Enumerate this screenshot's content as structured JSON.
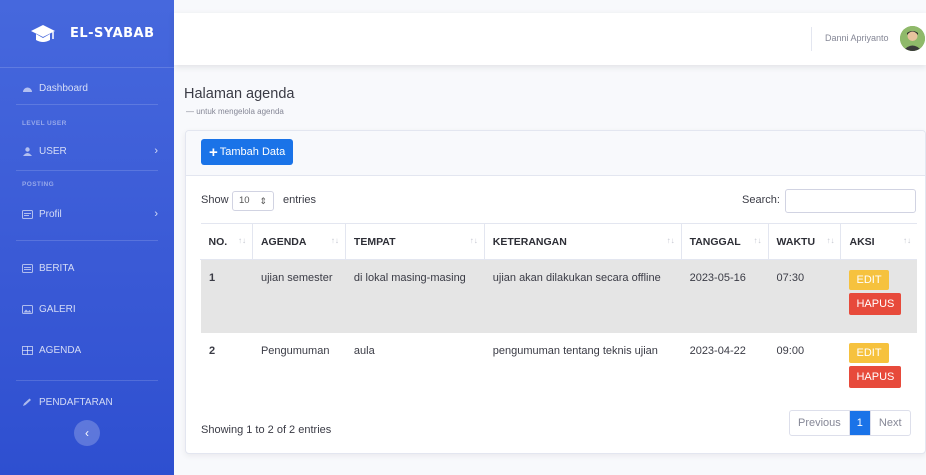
{
  "sidebar": {
    "brand": "EL-SYABAB",
    "dashboard": "Dashboard",
    "section_level_user": "LEVEL USER",
    "user": "USER",
    "section_posting": "POSTING",
    "profil": "Profil",
    "berita": "BERITA",
    "galeri": "GALERI",
    "agenda": "AGENDA",
    "pendaftaran": "PENDAFTARAN",
    "toggle_glyph": "‹"
  },
  "topbar": {
    "username": "Danni Apriyanto"
  },
  "page": {
    "title": "Halaman agenda",
    "subtitle": "— untuk mengelola agenda"
  },
  "card": {
    "add_button": "Tambah Data",
    "add_glyph": "+",
    "show_label": "Show",
    "page_length": "10",
    "entries_label": "entries",
    "search_label": "Search:",
    "search_value": "",
    "info": "Showing 1 to 2 of 2 entries"
  },
  "table": {
    "headers": [
      "NO.",
      "AGENDA",
      "TEMPAT",
      "KETERANGAN",
      "TANGGAL",
      "WAKTU",
      "AKSI"
    ],
    "rows": [
      {
        "no": "1",
        "agenda": "ujian semester",
        "tempat": "di lokal masing-masing",
        "keterangan": "ujian akan dilakukan secara offline",
        "tanggal": "2023-05-16",
        "waktu": "07:30",
        "edit": "EDIT",
        "hapus": "HAPUS"
      },
      {
        "no": "2",
        "agenda": "Pengumuman",
        "tempat": "aula",
        "keterangan": "pengumuman tentang teknis ujian",
        "tanggal": "2023-04-22",
        "waktu": "09:00",
        "edit": "EDIT",
        "hapus": "HAPUS"
      }
    ]
  },
  "pagination": {
    "previous": "Previous",
    "page": "1",
    "next": "Next"
  },
  "colors": {
    "sidebar": "#4668dd",
    "primary": "#1a73e8",
    "warning": "#f6c23e",
    "danger": "#e74a3b"
  }
}
